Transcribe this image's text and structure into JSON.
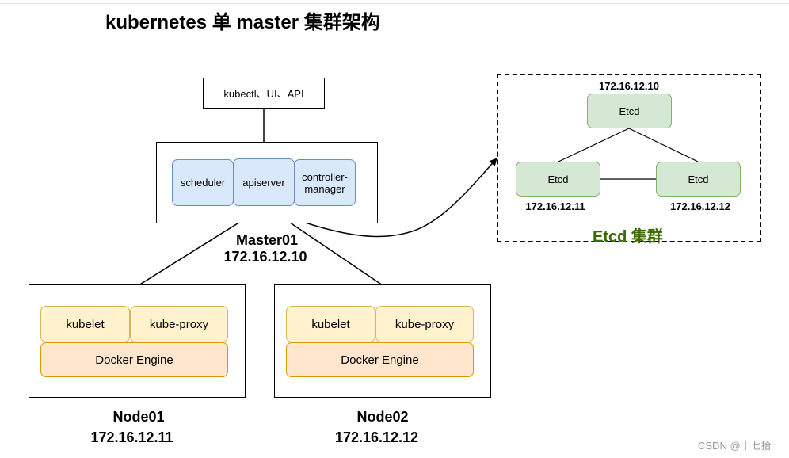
{
  "title": "kubernetes 单 master 集群架构",
  "client": {
    "label": "kubectl、UI、API"
  },
  "master": {
    "components": [
      "scheduler",
      "apiserver",
      "controller-\nmanager"
    ],
    "name": "Master01",
    "ip": "172.16.12.10"
  },
  "nodes": [
    {
      "kubelet": "kubelet",
      "proxy": "kube-proxy",
      "engine": "Docker Engine",
      "name": "Node01",
      "ip": "172.16.12.11"
    },
    {
      "kubelet": "kubelet",
      "proxy": "kube-proxy",
      "engine": "Docker Engine",
      "name": "Node02",
      "ip": "172.16.12.12"
    }
  ],
  "etcd": {
    "title": "Etcd 集群",
    "members": [
      {
        "label": "Etcd",
        "ip": "172.16.12.10"
      },
      {
        "label": "Etcd",
        "ip": "172.16.12.11"
      },
      {
        "label": "Etcd",
        "ip": "172.16.12.12"
      }
    ]
  },
  "watermark": "CSDN @十七拾",
  "colors": {
    "master_fill": "#dae8fc",
    "master_stroke": "#6c8ebf",
    "node_fill": "#fff2cc",
    "node_stroke": "#d6b656",
    "engine_fill": "#ffe6cc",
    "engine_stroke": "#d79b00",
    "etcd_fill": "#d5e8d4",
    "etcd_stroke": "#82b366",
    "etcd_title": "#3a6b00"
  }
}
